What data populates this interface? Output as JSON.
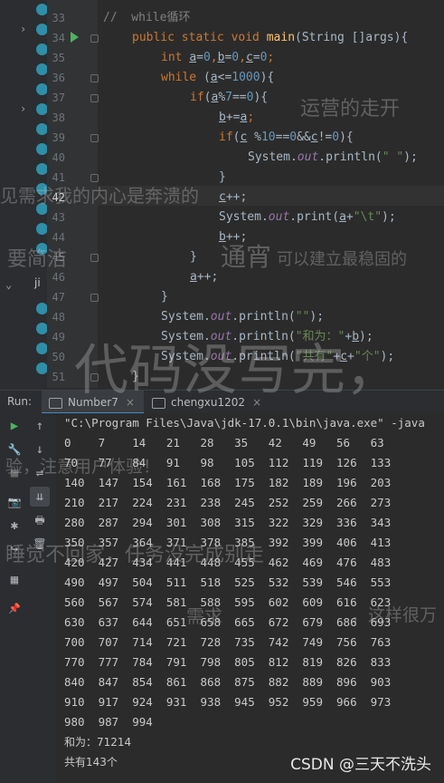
{
  "editor": {
    "line_numbers": [
      "33",
      "34",
      "35",
      "36",
      "37",
      "38",
      "39",
      "40",
      "41",
      "42",
      "43",
      "44",
      "45",
      "46",
      "47",
      "48",
      "49",
      "50",
      "51"
    ],
    "current_line": "42",
    "project_partial_label": "ji",
    "code": {
      "l33": "//  while循环",
      "l34_kw1": "public static void ",
      "l34_fn": "main",
      "l34_rest": "(String []args){",
      "l35_kw": "int ",
      "l35_a": "a",
      "l35_eq0a": "=",
      "l35_n0a": "0",
      "l35_c1": ",",
      "l35_b": "b",
      "l35_eq0b": "=",
      "l35_n0b": "0",
      "l35_c2": ",",
      "l35_c": "c",
      "l35_eq0c": "=",
      "l35_n0c": "0",
      "l35_end": ";",
      "l36_kw": "while ",
      "l36_p": "(",
      "l36_a": "a",
      "l36_op": "<=",
      "l36_n": "1000",
      "l36_end": "){",
      "l37_kw": "if",
      "l37_p": "(",
      "l37_a": "a",
      "l37_op": "%",
      "l37_n7": "7",
      "l37_eq": "==",
      "l37_n0": "0",
      "l37_end": "){",
      "l38_b": "b",
      "l38_op": "+=",
      "l38_a": "a",
      "l38_end": ";",
      "l39_kw": "if",
      "l39_p": "(",
      "l39_c": "c",
      "l39_op": " %",
      "l39_n10": "10",
      "l39_eq": "==",
      "l39_n0": "0",
      "l39_and": "&&",
      "l39_c2": "c",
      "l39_ne": "!=",
      "l39_n0b": "0",
      "l39_end": "){",
      "l40_sys": "System.",
      "l40_out": "out",
      "l40_m": ".println(",
      "l40_s": "\" \"",
      "l40_end": ");",
      "l41": "}",
      "l42_c": "c",
      "l42_rest": "++;",
      "l43_sys": "System.",
      "l43_out": "out",
      "l43_m": ".print(",
      "l43_a": "a",
      "l43_plus": "+",
      "l43_s": "\"\\t\"",
      "l43_end": ");",
      "l44_b": "b",
      "l44_rest": "++;",
      "l45": "}",
      "l46_a": "a",
      "l46_rest": "++;",
      "l47": "}",
      "l48_sys": "System.",
      "l48_out": "out",
      "l48_m": ".println(",
      "l48_s": "\"\"",
      "l48_end": ");",
      "l49_sys": "System.",
      "l49_out": "out",
      "l49_m": ".println(",
      "l49_s": "\"和为：\"",
      "l49_plus": "+",
      "l49_b": "b",
      "l49_end": ");",
      "l50_sys": "System.",
      "l50_out": "out",
      "l50_m": ".println(",
      "l50_s": "\"共有\"",
      "l50_plus1": "+",
      "l50_c": "c",
      "l50_plus2": "+",
      "l50_s2": "\"个\"",
      "l50_end": ");",
      "l51": "}"
    }
  },
  "run_panel": {
    "label": "Run:",
    "tabs": [
      {
        "label": "Number7",
        "active": true
      },
      {
        "label": "chengxu1202",
        "active": false
      }
    ],
    "close_glyph": "×"
  },
  "tools": {
    "rerun": "▶",
    "up": "↑",
    "wrench": "🔧",
    "down": "↓",
    "stop": "■",
    "wrap": "⇌",
    "camera": "📷",
    "scroll_end": "⇊",
    "bug": "✱",
    "print": "🖶",
    "exit": "↪",
    "delete": "🗑",
    "layout": "▦",
    "pin": "📌"
  },
  "console": {
    "lines": [
      "\"C:\\Program Files\\Java\\jdk-17.0.1\\bin\\java.exe\" -java",
      "0    7    14   21   28   35   42   49   56   63",
      "70   77   84   91   98   105  112  119  126  133",
      "140  147  154  161  168  175  182  189  196  203",
      "210  217  224  231  238  245  252  259  266  273",
      "280  287  294  301  308  315  322  329  336  343",
      "350  357  364  371  378  385  392  399  406  413",
      "420  427  434  441  448  455  462  469  476  483",
      "490  497  504  511  518  525  532  539  546  553",
      "560  567  574  581  588  595  602  609  616  623",
      "630  637  644  651  658  665  672  679  686  693",
      "700  707  714  721  728  735  742  749  756  763",
      "770  777  784  791  798  805  812  819  826  833",
      "840  847  854  861  868  875  882  889  896  903",
      "910  917  924  931  938  945  952  959  966  973",
      "980  987  994"
    ],
    "sum_line": "和为：71214",
    "count_line": "共有143个"
  },
  "watermarks": {
    "w1": "运营的走开",
    "w2": "见需求我的内心是奔溃的",
    "w3": "要简洁",
    "w4": "通宵",
    "w5": "可以建立最稳固的",
    "w6": "代码没写完，",
    "w7": "验，注意用户体验！",
    "w8": "睡觉不回家，任务没完成别走",
    "w9": "需求",
    "w10": "，这样很万"
  },
  "csdn_mark": "CSDN @三天不洗头"
}
